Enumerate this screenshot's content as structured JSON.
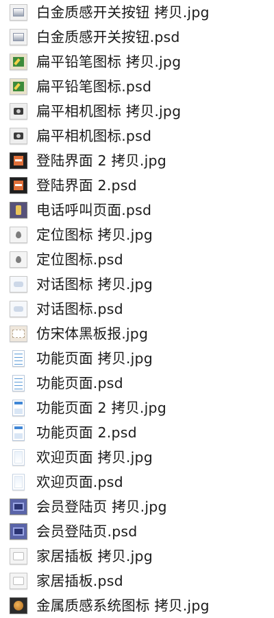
{
  "files": [
    {
      "name": "白金质感开关按钮 拷贝.jpg",
      "icon": "chrome-switch-thumbnail-icon",
      "thumb": "t-chrome"
    },
    {
      "name": "白金质感开关按钮.psd",
      "icon": "chrome-switch-thumbnail-icon",
      "thumb": "t-chrome"
    },
    {
      "name": "扁平铅笔图标 拷贝.jpg",
      "icon": "pencil-thumbnail-icon",
      "thumb": "t-pencil"
    },
    {
      "name": "扁平铅笔图标.psd",
      "icon": "pencil-thumbnail-icon",
      "thumb": "t-pencil"
    },
    {
      "name": "扁平相机图标 拷贝.jpg",
      "icon": "camera-thumbnail-icon",
      "thumb": "t-camera"
    },
    {
      "name": "扁平相机图标.psd",
      "icon": "camera-thumbnail-icon",
      "thumb": "t-camera"
    },
    {
      "name": "登陆界面 2 拷贝.jpg",
      "icon": "login-screen-thumbnail-icon",
      "thumb": "t-login"
    },
    {
      "name": "登陆界面 2.psd",
      "icon": "login-screen-thumbnail-icon",
      "thumb": "t-login"
    },
    {
      "name": "电话呼叫页面.psd",
      "icon": "phone-call-thumbnail-icon",
      "thumb": "t-phone"
    },
    {
      "name": "定位图标 拷贝.jpg",
      "icon": "location-pin-thumbnail-icon",
      "thumb": "t-pin"
    },
    {
      "name": "定位图标.psd",
      "icon": "location-pin-thumbnail-icon",
      "thumb": "t-pin"
    },
    {
      "name": "对话图标 拷贝.jpg",
      "icon": "chat-thumbnail-icon",
      "thumb": "t-chat"
    },
    {
      "name": "对话图标.psd",
      "icon": "chat-thumbnail-icon",
      "thumb": "t-chat"
    },
    {
      "name": "仿宋体黑板报.jpg",
      "icon": "blackboard-thumbnail-icon",
      "thumb": "t-board"
    },
    {
      "name": "功能页面 拷贝.jpg",
      "icon": "function-page-thumbnail-icon",
      "thumb": "t-page"
    },
    {
      "name": "功能页面.psd",
      "icon": "function-page-thumbnail-icon",
      "thumb": "t-page"
    },
    {
      "name": "功能页面 2 拷贝.jpg",
      "icon": "function-page-2-thumbnail-icon",
      "thumb": "t-page2"
    },
    {
      "name": "功能页面 2.psd",
      "icon": "function-page-2-thumbnail-icon",
      "thumb": "t-page2"
    },
    {
      "name": "欢迎页面 拷贝.jpg",
      "icon": "welcome-page-thumbnail-icon",
      "thumb": "t-welcome"
    },
    {
      "name": "欢迎页面.psd",
      "icon": "welcome-page-thumbnail-icon",
      "thumb": "t-welcome"
    },
    {
      "name": "会员登陆页 拷贝.jpg",
      "icon": "member-login-thumbnail-icon",
      "thumb": "t-member"
    },
    {
      "name": "会员登陆页.psd",
      "icon": "member-login-thumbnail-icon",
      "thumb": "t-member"
    },
    {
      "name": "家居插板 拷贝.jpg",
      "icon": "power-strip-thumbnail-icon",
      "thumb": "t-socket"
    },
    {
      "name": "家居插板.psd",
      "icon": "power-strip-thumbnail-icon",
      "thumb": "t-socket"
    },
    {
      "name": "金属质感系统图标 拷贝.jpg",
      "icon": "metal-system-thumbnail-icon",
      "thumb": "t-metal"
    }
  ]
}
